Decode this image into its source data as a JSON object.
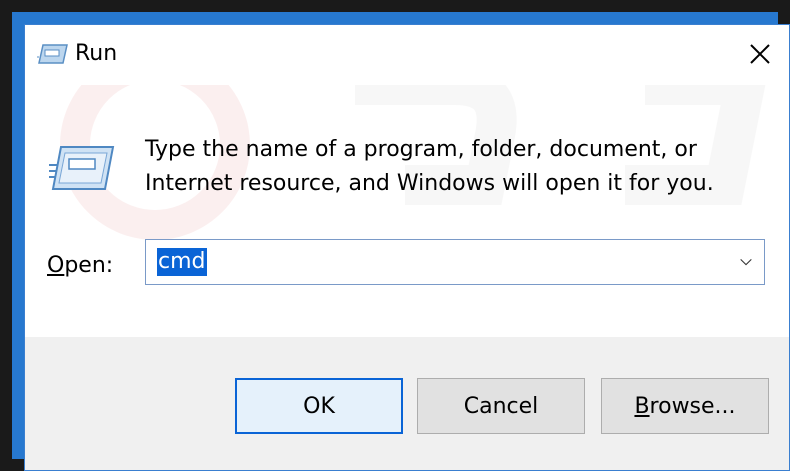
{
  "window": {
    "title": "Run",
    "icon": "run-icon",
    "close_icon": "close-icon"
  },
  "content": {
    "description_line1": "Type the name of a program, folder, document, or",
    "description_line2": "Internet resource, and Windows will open it for you.",
    "open_label_prefix": "O",
    "open_label_rest": "pen:",
    "input_value": "cmd",
    "dropdown_icon": "chevron-down-icon"
  },
  "buttons": {
    "ok": "OK",
    "cancel": "Cancel",
    "browse_prefix": "B",
    "browse_rest": "rowse..."
  },
  "colors": {
    "accent": "#0a64d6",
    "border_blue": "#2778cf"
  }
}
